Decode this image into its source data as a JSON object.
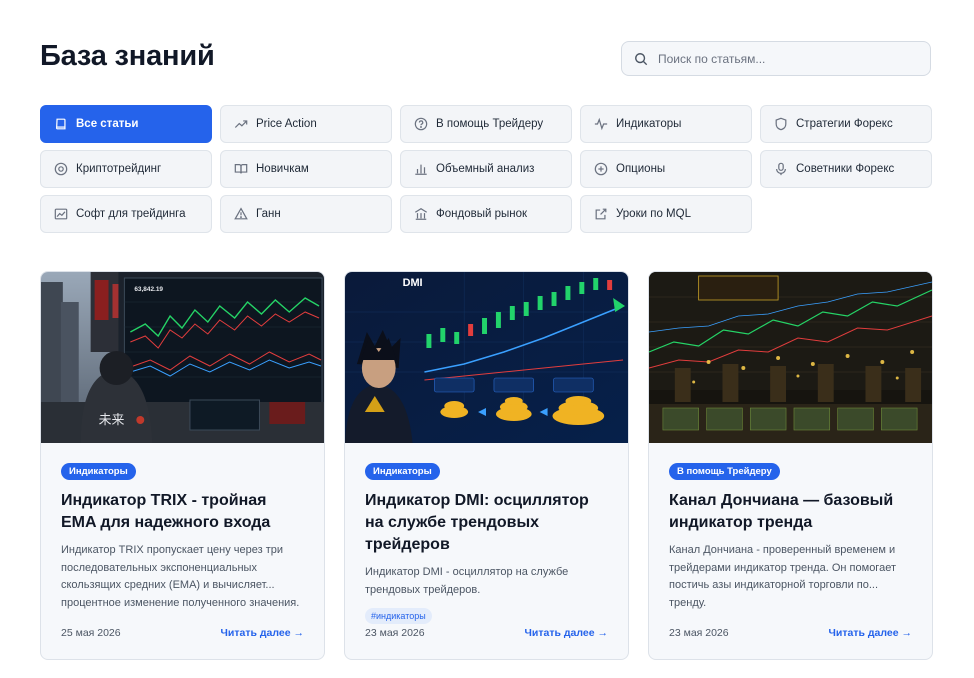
{
  "page": {
    "title": "База знаний"
  },
  "search": {
    "placeholder": "Поиск по статьям..."
  },
  "categories": [
    {
      "label": "Все статьи",
      "icon": "book-icon",
      "active": true
    },
    {
      "label": "Price Action",
      "icon": "trend-up-icon"
    },
    {
      "label": "В помощь Трейдеру",
      "icon": "help-circle-icon"
    },
    {
      "label": "Индикаторы",
      "icon": "pulse-icon"
    },
    {
      "label": "Стратегии Форекс",
      "icon": "shield-icon"
    },
    {
      "label": "Криптотрейдинг",
      "icon": "coin-icon"
    },
    {
      "label": "Новичкам",
      "icon": "open-book-icon"
    },
    {
      "label": "Объемный анализ",
      "icon": "bar-chart-icon"
    },
    {
      "label": "Опционы",
      "icon": "plus-circle-icon"
    },
    {
      "label": "Советники Форекс",
      "icon": "microphone-icon"
    },
    {
      "label": "Софт для трейдинга",
      "icon": "chart-window-icon"
    },
    {
      "label": "Ганн",
      "icon": "warning-triangle-icon"
    },
    {
      "label": "Фондовый рынок",
      "icon": "building-icon"
    },
    {
      "label": "Уроки по MQL",
      "icon": "external-link-icon"
    }
  ],
  "articles": [
    {
      "badge": "Индикаторы",
      "title": "Индикатор TRIX - тройная EMA для надежного входа",
      "excerpt": "Индикатор TRIX пропускает цену через три последовательных экспоненциальных скользящих средних (EMA) и вычисляет... процентное изменение полученного значения.",
      "date": "25 мая 2026",
      "read_more": "Читать далее →"
    },
    {
      "badge": "Индикаторы",
      "title": "Индикатор DMI: осциллятор на службе трендовых трейдеров",
      "excerpt": "Индикатор DMI - осциллятор на службе трендовых трейдеров.",
      "tag": "#индикаторы",
      "date": "23 мая 2026",
      "read_more": "Читать далее →"
    },
    {
      "badge": "В помощь Трейдеру",
      "title": "Канал Дончиана — базовый индикатор тренда",
      "excerpt": "Канал Дончиана - проверенный временем и трейдерами индикатор тренда. Он помогает постичь азы индикаторной торговли по... тренду.",
      "date": "23 мая 2026",
      "read_more": "Читать далее →"
    }
  ],
  "images": {
    "img1_text": {
      "price": "63,842.19",
      "kanji": "未来"
    },
    "img2_text": {
      "title": "DMI"
    }
  },
  "colors": {
    "accent": "#2563eb",
    "title": "#111827",
    "card_bg": "#f6f8fb"
  }
}
